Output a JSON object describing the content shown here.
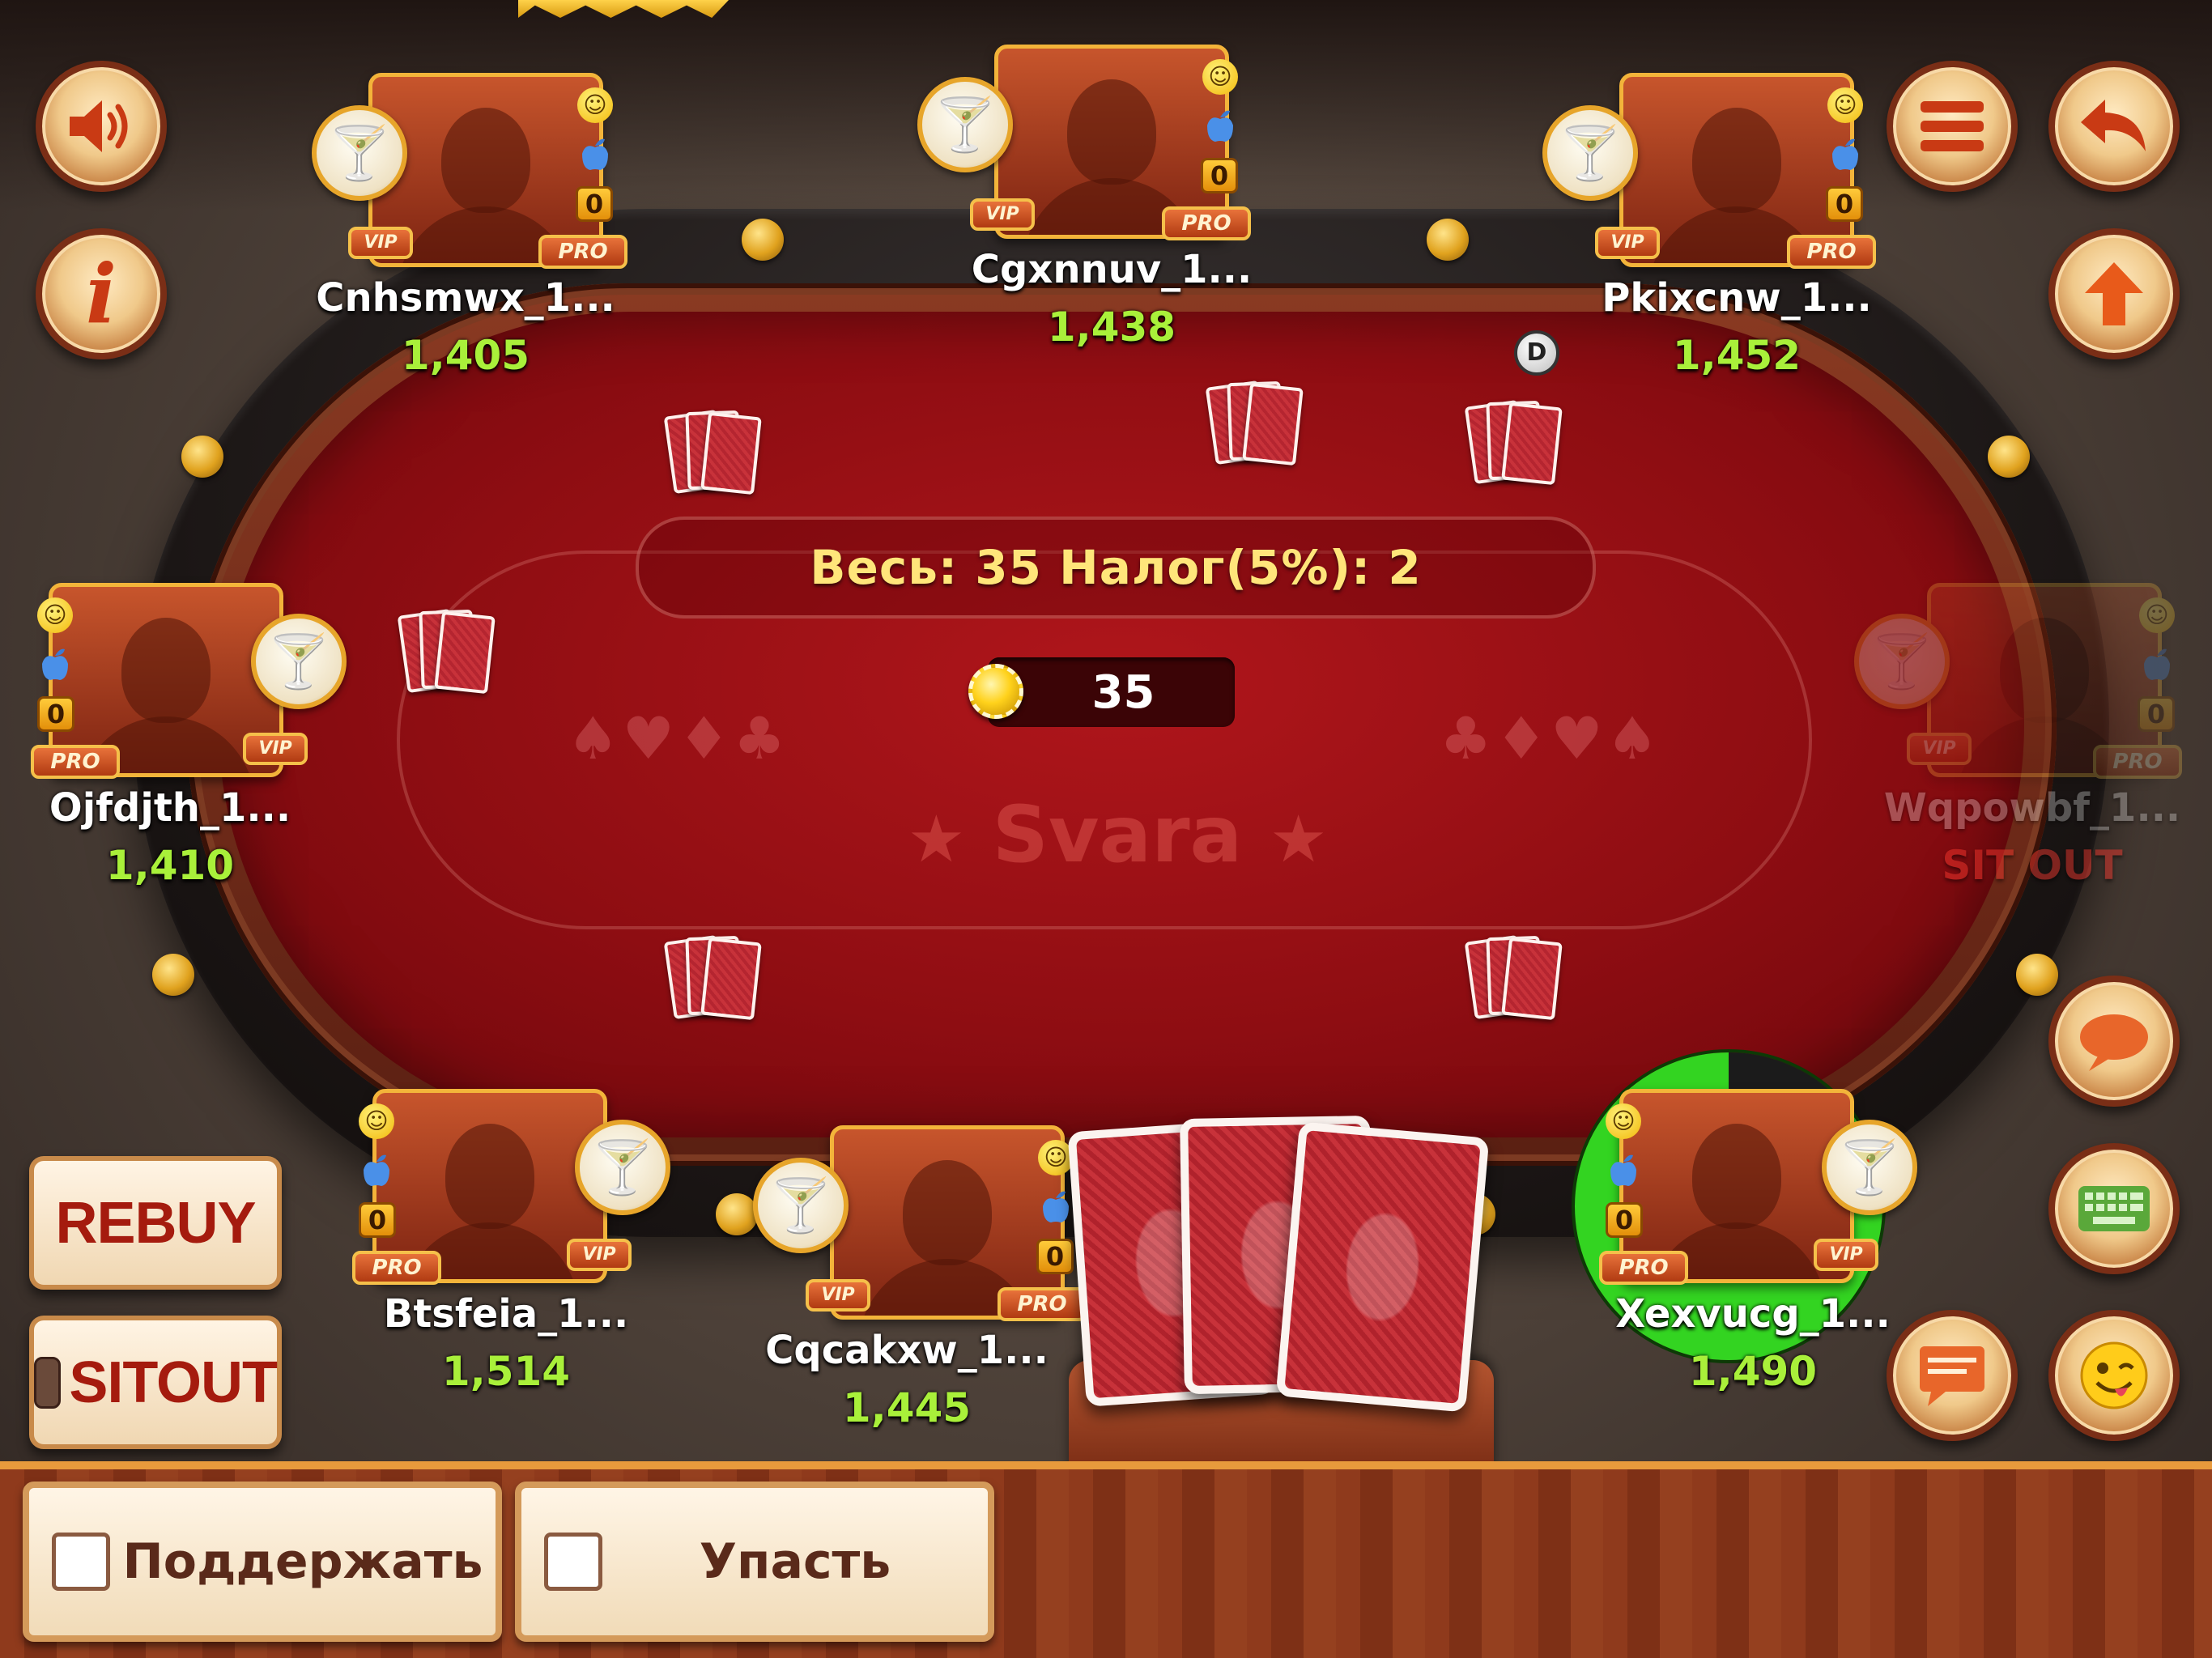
{
  "table": {
    "pot_info": "Весь: 35 Налог(5%): 2",
    "pot_amount": "35",
    "brand": "Svara",
    "suits_left": "♠♥♦♣",
    "suits_right": "♣♦♥♠",
    "dealer_label": "D"
  },
  "players": [
    {
      "name": "Cnhsmwx_1...",
      "chips": "1,405",
      "level": "0",
      "pro_label": "PRO",
      "vip_label": "VIP"
    },
    {
      "name": "Cgxnnuv_1...",
      "chips": "1,438",
      "level": "0",
      "pro_label": "PRO",
      "vip_label": "VIP"
    },
    {
      "name": "Pkixcnw_1...",
      "chips": "1,452",
      "level": "0",
      "pro_label": "PRO",
      "vip_label": "VIP"
    },
    {
      "name": "Ojfdjth_1...",
      "chips": "1,410",
      "level": "0",
      "pro_label": "PRO",
      "vip_label": "VIP"
    },
    {
      "name": "Wqpowbf_1...",
      "chips": "",
      "status": "SIT OUT",
      "level": "0",
      "pro_label": "PRO",
      "vip_label": "VIP"
    },
    {
      "name": "Btsfeia_1...",
      "chips": "1,514",
      "level": "0",
      "pro_label": "PRO",
      "vip_label": "VIP"
    },
    {
      "name": "Cqcakxw_1...",
      "chips": "1,445",
      "level": "0",
      "pro_label": "PRO",
      "vip_label": "VIP"
    },
    {
      "name": "Xexvucg_1...",
      "chips": "1,490",
      "level": "0",
      "pro_label": "PRO",
      "vip_label": "VIP",
      "turn_timer_remaining": 0.87
    }
  ],
  "side_buttons": {
    "rebuy": "REBUY",
    "sitout": "SITOUT"
  },
  "actions": {
    "support": "Поддержать",
    "fold": "Упасть"
  },
  "icons": [
    "sound-icon",
    "info-icon",
    "menu-icon",
    "back-icon",
    "up-arrow-icon",
    "chat-bubble-icon",
    "keyboard-icon",
    "message-icon",
    "emoji-icon",
    "cocktail-icon",
    "apple-icon",
    "smiley-icon"
  ],
  "colors": {
    "felt": "#9a0f14",
    "chips_text": "#a9f03a",
    "pot_text": "#ffe57a",
    "sitout_text": "#ff3a30",
    "timer": "#33d421"
  }
}
